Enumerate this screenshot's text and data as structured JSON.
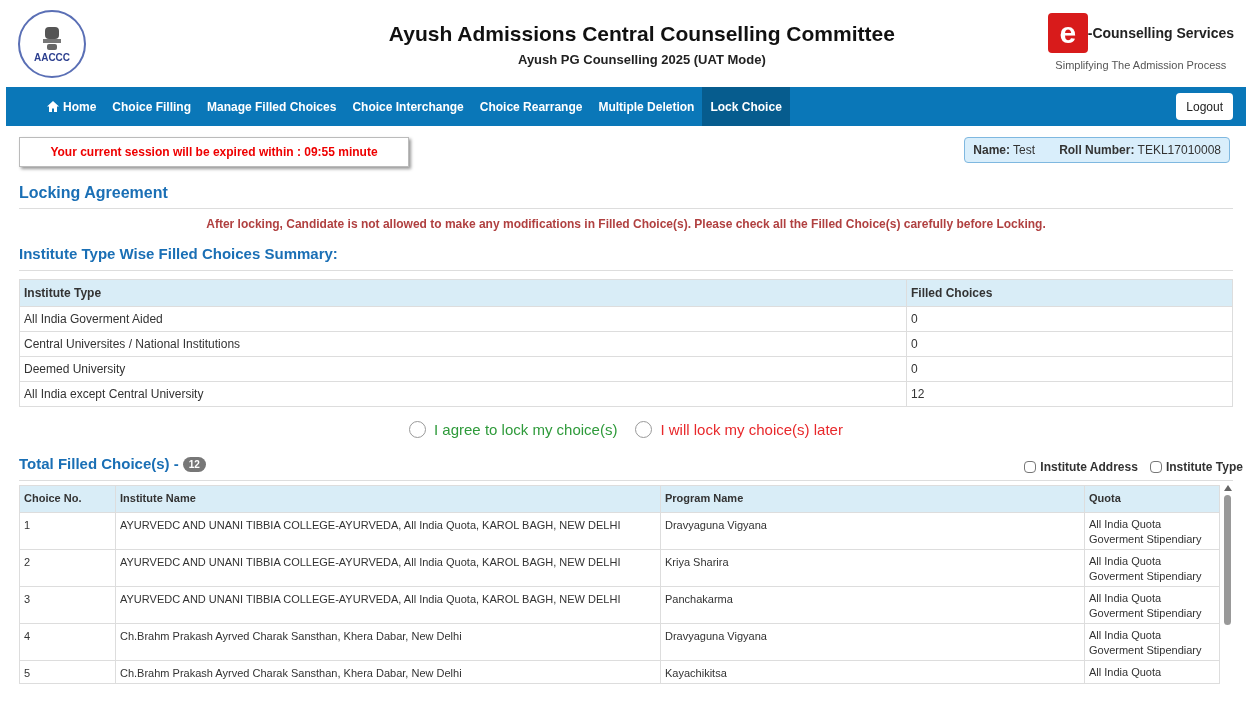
{
  "header": {
    "logo_text": "AACCC",
    "title": "Ayush Admissions Central Counselling Committee",
    "subtitle": "Ayush PG Counselling 2025 (UAT Mode)",
    "brand_letter": "e",
    "brand_name": "-Counselling Services",
    "brand_tagline": "Simplifying The Admission Process"
  },
  "nav": {
    "items": [
      {
        "label": "Home",
        "kind": "home",
        "selected": false
      },
      {
        "label": "Choice Filling",
        "kind": "link",
        "selected": false
      },
      {
        "label": "Manage Filled Choices",
        "kind": "link",
        "selected": false
      },
      {
        "label": "Choice Interchange",
        "kind": "link",
        "selected": false
      },
      {
        "label": "Choice Rearrange",
        "kind": "link",
        "selected": false
      },
      {
        "label": "Multiple Deletion",
        "kind": "link",
        "selected": false
      },
      {
        "label": "Lock Choice",
        "kind": "link",
        "selected": true
      }
    ],
    "logout": "Logout"
  },
  "session_notice": "Your current session will be expired within : 09:55 minute",
  "candidate": {
    "name_label": "Name:",
    "name": "Test",
    "roll_label": "Roll Number:",
    "roll": "TEKL17010008"
  },
  "section_title": "Locking Agreement",
  "warning": "After locking, Candidate is not allowed to make any modifications in Filled Choice(s). Please check all the Filled Choice(s) carefully before Locking.",
  "summary": {
    "title": "Institute Type Wise Filled Choices Summary:",
    "columns": [
      "Institute Type",
      "Filled Choices"
    ],
    "rows": [
      [
        "All India Goverment Aided",
        "0"
      ],
      [
        "Central Universites / National Institutions",
        "0"
      ],
      [
        "Deemed University",
        "0"
      ],
      [
        "All India except Central University",
        "12"
      ]
    ]
  },
  "lock_options": [
    {
      "label": "I agree to lock my choice(s)",
      "selected": false,
      "color": "#2e9a3a"
    },
    {
      "label": "I will lock my choice(s) later",
      "selected": false,
      "color": "#e8282b"
    }
  ],
  "choices": {
    "title": "Total Filled Choice(s) -",
    "count": "12",
    "toggles": [
      {
        "label": "Institute Address",
        "checked": false
      },
      {
        "label": "Institute Type",
        "checked": false
      }
    ],
    "columns": [
      "Choice No.",
      "Institute Name",
      "Program Name",
      "Quota"
    ],
    "rows": [
      {
        "no": "1",
        "institute": "AYURVEDC AND UNANI TIBBIA COLLEGE-AYURVEDA, All India Quota, KAROL BAGH, NEW DELHI",
        "program": "Dravyaguna Vigyana",
        "quota": [
          "All India Quota",
          "Goverment Stipendiary"
        ]
      },
      {
        "no": "2",
        "institute": "AYURVEDC AND UNANI TIBBIA COLLEGE-AYURVEDA, All India Quota, KAROL BAGH, NEW DELHI",
        "program": "Kriya Sharira",
        "quota": [
          "All India Quota",
          "Goverment Stipendiary"
        ]
      },
      {
        "no": "3",
        "institute": "AYURVEDC AND UNANI TIBBIA COLLEGE-AYURVEDA, All India Quota, KAROL BAGH, NEW DELHI",
        "program": "Panchakarma",
        "quota": [
          "All India Quota",
          "Goverment Stipendiary"
        ]
      },
      {
        "no": "4",
        "institute": "Ch.Brahm Prakash Ayrved Charak Sansthan, Khera Dabar, New Delhi",
        "program": "Dravyaguna Vigyana",
        "quota": [
          "All India Quota",
          "Goverment Stipendiary"
        ]
      },
      {
        "no": "5",
        "institute": "Ch.Brahm Prakash Ayrved Charak Sansthan, Khera Dabar, New Delhi",
        "program": "Kayachikitsa",
        "quota": [
          "All India Quota"
        ]
      }
    ]
  }
}
